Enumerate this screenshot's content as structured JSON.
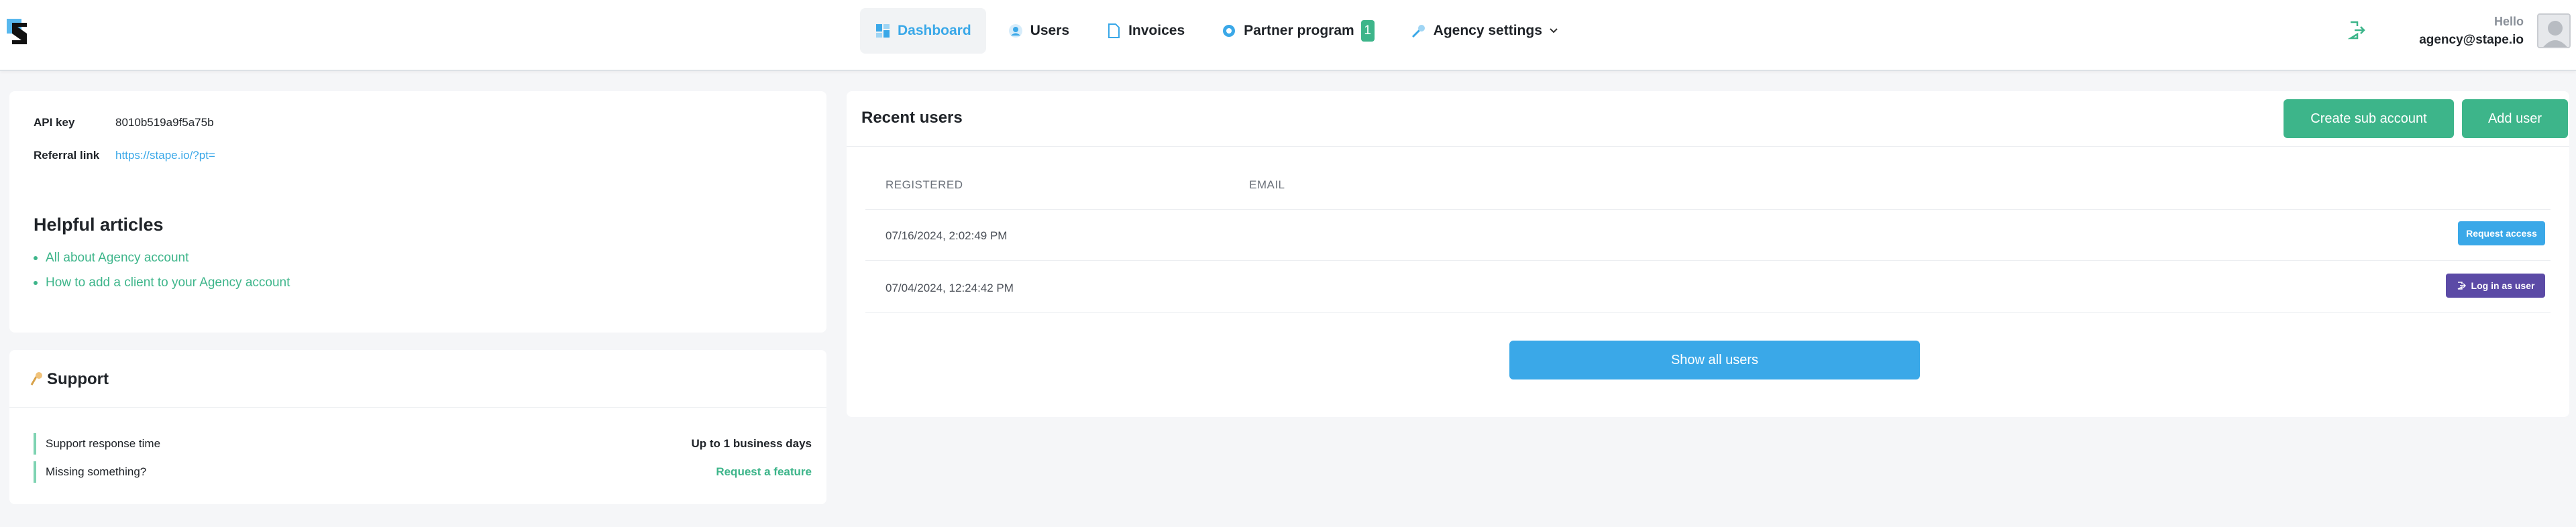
{
  "nav": {
    "items": [
      {
        "label": "Dashboard",
        "icon": "dashboard-icon",
        "active": true
      },
      {
        "label": "Users",
        "icon": "users-icon"
      },
      {
        "label": "Invoices",
        "icon": "invoice-icon"
      },
      {
        "label": "Partner program",
        "icon": "partner-icon",
        "badge": "1"
      },
      {
        "label": "Agency settings",
        "icon": "wrench-icon"
      }
    ]
  },
  "user": {
    "greeting": "Hello",
    "email": "agency@stape.io"
  },
  "api": {
    "key_label": "API key",
    "key_value": "8010b519a9f5a75b",
    "referral_label": "Referral link",
    "referral_value": "https://stape.io/?pt="
  },
  "articles": {
    "title": "Helpful articles",
    "items": [
      "All about Agency account",
      "How to add a client to your Agency account"
    ]
  },
  "support": {
    "title": "Support",
    "rows": [
      {
        "label": "Support response time",
        "value": "Up to 1 business days"
      },
      {
        "label": "Missing something?",
        "value": "Request a feature"
      }
    ]
  },
  "recent_users": {
    "title": "Recent users",
    "create_button": "Create sub account",
    "add_button": "Add user",
    "columns": [
      "REGISTERED",
      "EMAIL"
    ],
    "rows": [
      {
        "registered": "07/16/2024, 2:02:49 PM",
        "email": "",
        "action": "Request access"
      },
      {
        "registered": "07/04/2024, 12:24:42 PM",
        "email": "",
        "action": "Log in as user"
      }
    ],
    "show_all": "Show all users"
  },
  "colors": {
    "accent_blue": "#3aa8e8",
    "accent_green": "#3db58a",
    "accent_purple": "#5b4aa6"
  }
}
